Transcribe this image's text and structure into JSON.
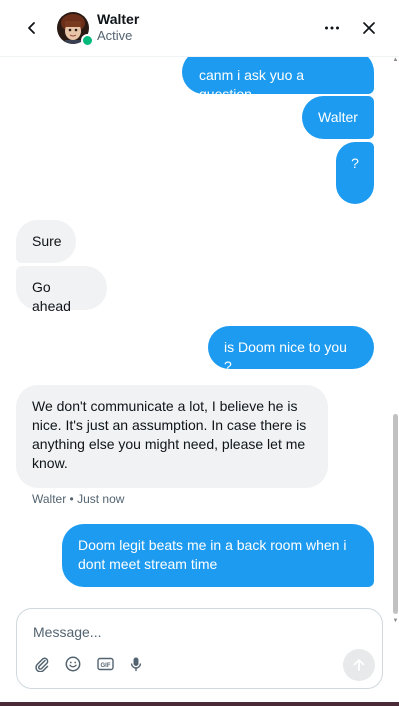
{
  "header": {
    "contact_name": "Walter",
    "contact_status": "Active",
    "icons": {
      "back": "chevron-left-icon",
      "more": "more-horizontal-icon",
      "close": "close-icon"
    }
  },
  "messages": [
    {
      "direction": "outgoing",
      "text": "canm i ask yuo a question"
    },
    {
      "direction": "outgoing",
      "text": "Walter"
    },
    {
      "direction": "outgoing",
      "text": "?"
    },
    {
      "direction": "incoming",
      "text": "Sure"
    },
    {
      "direction": "incoming",
      "text": "Go ahead"
    },
    {
      "direction": "outgoing",
      "text": "is Doom nice to you ?"
    },
    {
      "direction": "incoming",
      "text": "We don't communicate a lot, I believe he is nice. It's just an assumption. In case there is anything else you might need, please let me know."
    },
    {
      "direction": "outgoing",
      "text": "Doom legit beats me in a back room when i dont meet stream time"
    }
  ],
  "message_meta": "Walter • Just now",
  "composer": {
    "placeholder": "Message...",
    "value": "",
    "tools": [
      "attachment-icon",
      "emoji-icon",
      "gif-icon",
      "microphone-icon"
    ],
    "send_icon": "arrow-up-icon"
  },
  "colors": {
    "outgoing_bubble": "#1d9bf0",
    "incoming_bubble": "#f0f2f3",
    "online_indicator": "#00ba7c"
  }
}
